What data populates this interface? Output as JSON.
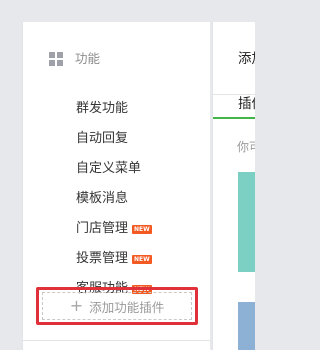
{
  "sidebar": {
    "section": {
      "title": "功能",
      "icon": "grid-icon"
    },
    "items": [
      {
        "label": "群发功能",
        "badge": ""
      },
      {
        "label": "自动回复",
        "badge": ""
      },
      {
        "label": "自定义菜单",
        "badge": ""
      },
      {
        "label": "模板消息",
        "badge": ""
      },
      {
        "label": "门店管理",
        "badge": "NEW"
      },
      {
        "label": "投票管理",
        "badge": "NEW"
      },
      {
        "label": "客服功能",
        "badge": "NEW"
      }
    ],
    "add_plugin": {
      "label": "添加功能插件",
      "icon": "plus-icon"
    }
  },
  "content": {
    "title": "添加",
    "active_tab": "插件",
    "hint": "你可"
  },
  "colors": {
    "badge": "#f25a22",
    "highlight": "#e0303a",
    "tab_accent": "#44b549",
    "card_teal": "#7ccfc3",
    "card_blue": "#8db1d5"
  }
}
